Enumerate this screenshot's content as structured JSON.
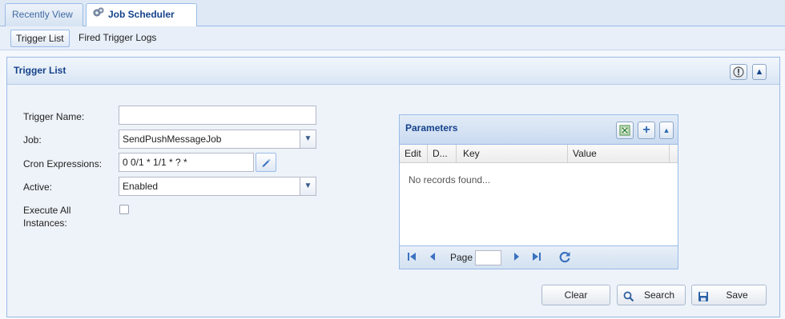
{
  "tabs": [
    {
      "label": "Recently View",
      "active": false
    },
    {
      "label": "Job Scheduler",
      "active": true,
      "icon": "gears-icon",
      "close": "✕"
    }
  ],
  "subtabs": [
    {
      "label": "Trigger List",
      "active": true
    },
    {
      "label": "Fired Trigger Logs",
      "active": false
    }
  ],
  "panel": {
    "title": "Trigger List",
    "help_icon": "help-icon",
    "collapse_icon": "collapse-up-icon"
  },
  "form": {
    "trigger_name_label": "Trigger Name:",
    "trigger_name_value": "",
    "job_label": "Job:",
    "job_value": "SendPushMessageJob",
    "cron_label": "Cron Expressions:",
    "cron_value": "0 0/1 * 1/1 * ? *",
    "active_label": "Active:",
    "active_value": "Enabled",
    "execute_all_label_line1": "Execute All",
    "execute_all_label_line2": "Instances:",
    "execute_all_checked": false
  },
  "parameters": {
    "title": "Parameters",
    "columns": [
      "Edit",
      "D...",
      "Key",
      "Value"
    ],
    "empty_text": "No records found...",
    "page_label": "Page",
    "page_value": ""
  },
  "buttons": {
    "clear": "Clear",
    "search": "Search",
    "save": "Save"
  },
  "colors": {
    "accent": "#15428b",
    "border": "#99bbe8"
  }
}
